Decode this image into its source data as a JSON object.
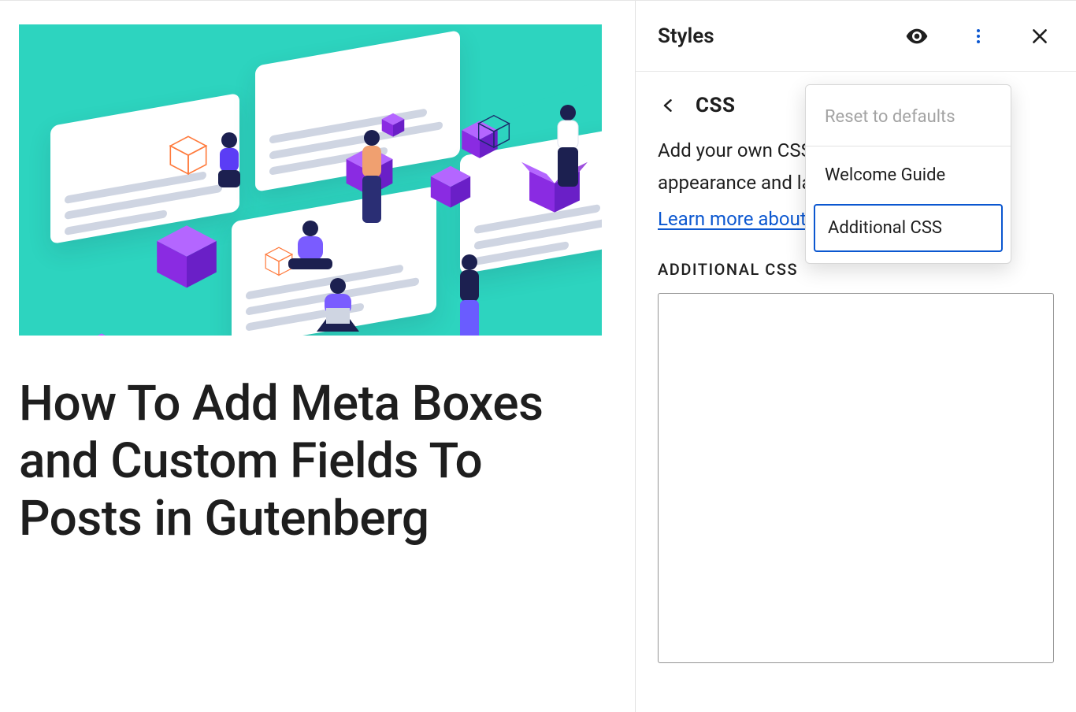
{
  "main": {
    "post_title": "How To Add Meta Boxes and Custom Fields To Posts in Gutenberg"
  },
  "sidebar": {
    "header_title": "Styles",
    "panel_title": "CSS",
    "description": "Add your own CSS to customize the appearance and layout of your site.",
    "learn_more": "Learn more about CSS",
    "section_label": "ADDITIONAL CSS",
    "css_value": ""
  },
  "popover": {
    "reset": "Reset to defaults",
    "welcome": "Welcome Guide",
    "additional": "Additional CSS"
  }
}
